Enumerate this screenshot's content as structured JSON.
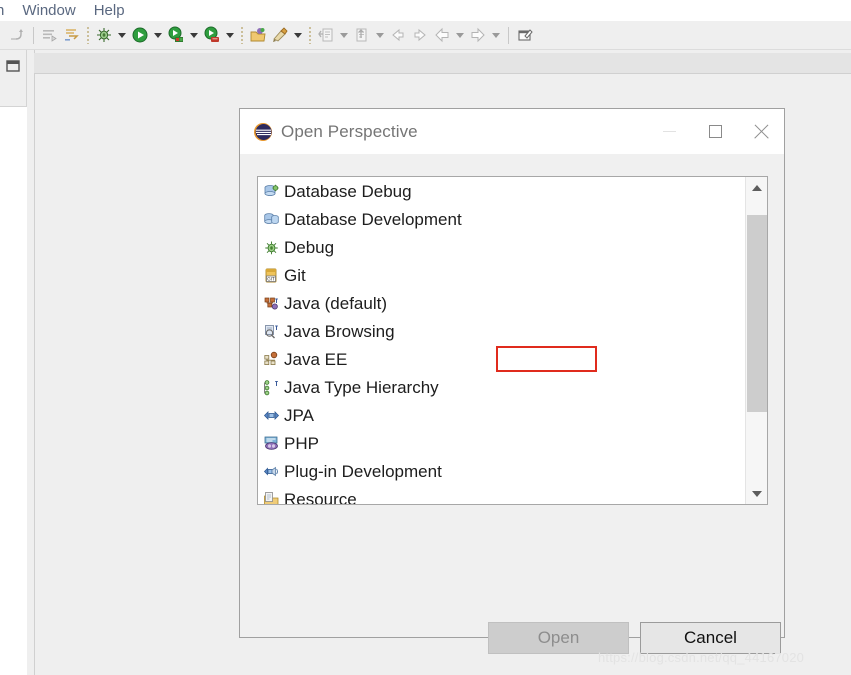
{
  "app": {
    "menubar": {
      "items": [
        {
          "label": "n",
          "clipped": true
        },
        {
          "label": "Window"
        },
        {
          "label": "Help"
        }
      ]
    },
    "toolbar": {
      "icons": [
        "skip-all-breakpoints-icon",
        "separator",
        "toggle-mark-occurrences-icon",
        "last-edit-location-icon",
        "dots-separator",
        "debug-icon",
        "debug-dropdown-arrow",
        "run-icon",
        "run-dropdown-arrow",
        "run-server-icon",
        "run-server-dropdown-arrow",
        "profile-icon",
        "profile-dropdown-arrow",
        "dots-separator",
        "open-type-icon",
        "new-java-class-icon",
        "new-java-class-dropdown-arrow",
        "dots-separator",
        "open-task-icon",
        "open-task-dropdown-arrow",
        "new-element-icon",
        "new-element-dropdown-arrow",
        "previous-annotation-icon",
        "next-annotation-icon",
        "back-icon",
        "back-dropdown-arrow",
        "forward-icon",
        "forward-dropdown-arrow",
        "separator",
        "new-editor-icon"
      ]
    },
    "left_panel": {
      "icon": "restore-perspective-icon"
    },
    "watermark": "https://blog.csdn.net/qq_44167020"
  },
  "dialog": {
    "icon": "eclipse-icon",
    "title": "Open Perspective",
    "window_controls": {
      "minimize": "minimize-icon",
      "maximize": "maximize-icon",
      "close": "close-icon"
    },
    "list": {
      "selected": "Java EE",
      "annotation_color": "#e02b1d",
      "items": [
        {
          "label": "Database Debug",
          "icon": "database-debug-icon"
        },
        {
          "label": "Database Development",
          "icon": "database-development-icon"
        },
        {
          "label": "Debug",
          "icon": "debug-bug-icon"
        },
        {
          "label": "Git",
          "icon": "git-icon"
        },
        {
          "label": "Java (default)",
          "icon": "java-icon"
        },
        {
          "label": "Java Browsing",
          "icon": "java-browsing-icon"
        },
        {
          "label": "Java EE",
          "icon": "java-ee-icon"
        },
        {
          "label": "Java Type Hierarchy",
          "icon": "java-type-hierarchy-icon"
        },
        {
          "label": "JPA",
          "icon": "jpa-icon"
        },
        {
          "label": "PHP",
          "icon": "php-icon"
        },
        {
          "label": "Plug-in Development",
          "icon": "plugin-development-icon"
        },
        {
          "label": "Resource",
          "icon": "resource-icon"
        }
      ],
      "scrollbar": {
        "up_icon": "chevron-up-icon",
        "down_icon": "chevron-down-icon",
        "thumb_top_pct": 6,
        "thumb_height_pct": 62
      }
    },
    "buttons": {
      "open": {
        "label": "Open",
        "enabled": false
      },
      "cancel": {
        "label": "Cancel",
        "enabled": true
      }
    }
  }
}
